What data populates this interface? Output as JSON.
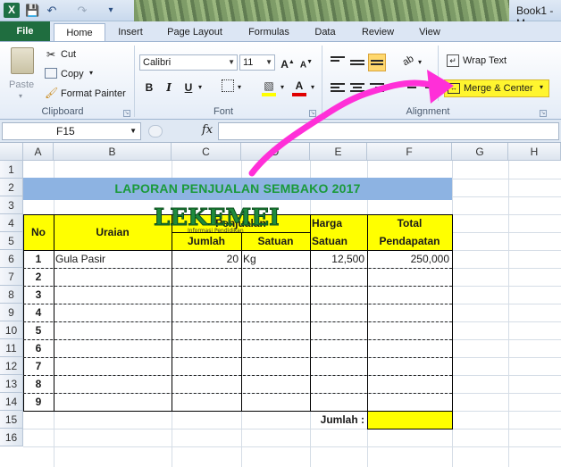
{
  "window": {
    "title": "Book1 - M"
  },
  "quick_access": {
    "save_icon": "save-icon",
    "undo_icon": "undo-icon",
    "redo_icon": "redo-icon",
    "customize": "▾"
  },
  "tabs": [
    "File",
    "Home",
    "Insert",
    "Page Layout",
    "Formulas",
    "Data",
    "Review",
    "View"
  ],
  "ribbon": {
    "clipboard": {
      "label": "Clipboard",
      "paste": "Paste",
      "cut": "Cut",
      "copy": "Copy",
      "format_painter": "Format Painter"
    },
    "font": {
      "label": "Font",
      "name": "Calibri",
      "size": "11",
      "bold": "B",
      "italic": "I",
      "underline": "U"
    },
    "alignment": {
      "label": "Alignment",
      "wrap_text": "Wrap Text",
      "merge_center": "Merge & Center"
    }
  },
  "formula_bar": {
    "name_box": "F15",
    "fx": "fx",
    "value": ""
  },
  "columns": [
    "A",
    "B",
    "C",
    "D",
    "E",
    "F",
    "G",
    "H"
  ],
  "rows": [
    "1",
    "2",
    "3",
    "4",
    "5",
    "6",
    "7",
    "8",
    "9",
    "10",
    "11",
    "12",
    "13",
    "14",
    "15",
    "16"
  ],
  "sheet": {
    "title": "LAPORAN PENJUALAN SEMBAKO 2017",
    "headers": {
      "no": "No",
      "uraian": "Uraian",
      "penjualan": "Penjualan",
      "jumlah": "Jumlah",
      "satuan": "Satuan",
      "harga": "Harga",
      "harga_satuan": "Satuan",
      "total": "Total",
      "pendapatan": "Pendapatan"
    },
    "rows": [
      {
        "no": "1",
        "uraian": "Gula Pasir",
        "jumlah": "20",
        "satuan": "Kg",
        "harga": "12,500",
        "total": "250,000"
      },
      {
        "no": "2",
        "uraian": "",
        "jumlah": "",
        "satuan": "",
        "harga": "",
        "total": ""
      },
      {
        "no": "3",
        "uraian": "",
        "jumlah": "",
        "satuan": "",
        "harga": "",
        "total": ""
      },
      {
        "no": "4",
        "uraian": "",
        "jumlah": "",
        "satuan": "",
        "harga": "",
        "total": ""
      },
      {
        "no": "5",
        "uraian": "",
        "jumlah": "",
        "satuan": "",
        "harga": "",
        "total": ""
      },
      {
        "no": "6",
        "uraian": "",
        "jumlah": "",
        "satuan": "",
        "harga": "",
        "total": ""
      },
      {
        "no": "7",
        "uraian": "",
        "jumlah": "",
        "satuan": "",
        "harga": "",
        "total": ""
      },
      {
        "no": "8",
        "uraian": "",
        "jumlah": "",
        "satuan": "",
        "harga": "",
        "total": ""
      },
      {
        "no": "9",
        "uraian": "",
        "jumlah": "",
        "satuan": "",
        "harga": "",
        "total": ""
      }
    ],
    "jumlah_label": "Jumlah :"
  },
  "watermark": {
    "text": "LEKEMEDE",
    "subtitle": "Informasi Pendidikan"
  },
  "colors": {
    "header_yellow": "#ffff00",
    "title_blue": "#8db3e2",
    "title_green": "#1a9a3a",
    "arrow_magenta": "#ff2fd8"
  }
}
